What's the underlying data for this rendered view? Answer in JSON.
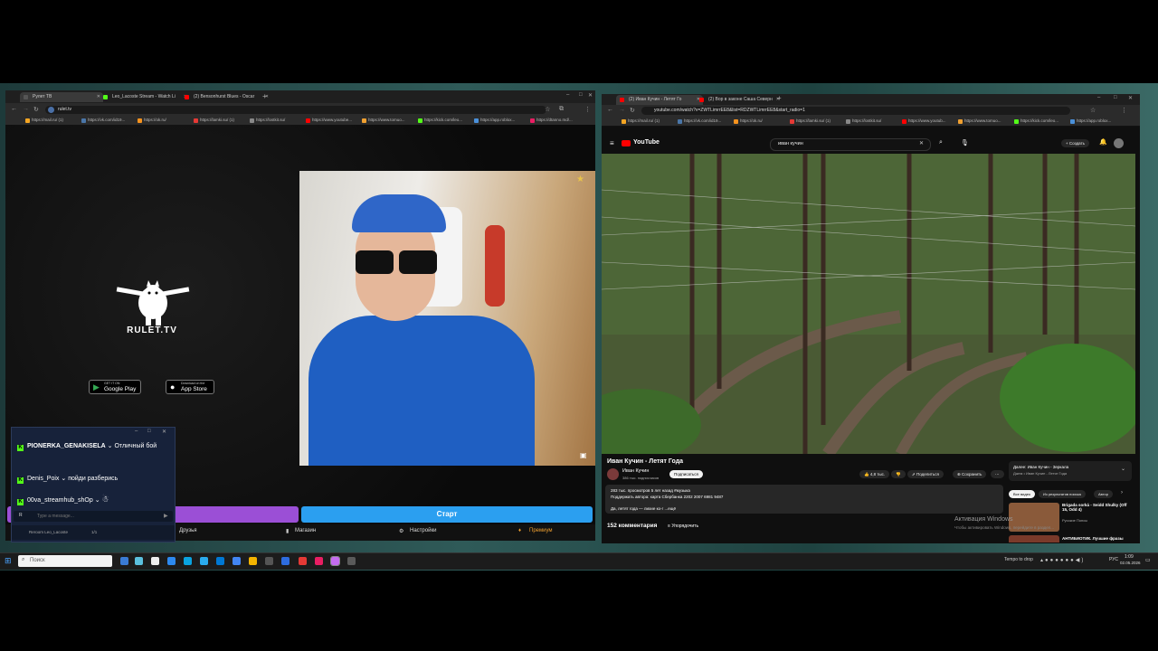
{
  "left_browser": {
    "tabs": [
      {
        "label": "Рулет ТВ",
        "color": "#2a2a2a"
      },
      {
        "label": "Leo_Lacoste Stream - Watch Li",
        "color": "#53fc18"
      },
      {
        "label": "(2) Bensonhurst Blues - Oscar",
        "color": "#ff0000"
      }
    ],
    "url": "rulet.tv",
    "bookmarks": [
      "https://mail.ru/ (1)",
      "https://vk.com/id19...",
      "https://ok.ru/",
      "https://lamki.su/ (1)",
      "https://lostkit.su/",
      "https://www.youtube...",
      "https://www.tomuo...",
      "https://kick.com/leo...",
      "https://app.roblox...",
      "https://dtanno.md/..."
    ]
  },
  "rulet": {
    "logo_text": "RULET.TV",
    "google_play": {
      "small": "GET IT ON",
      "label": "Google Play"
    },
    "app_store": {
      "small": "Download on the",
      "label": "App Store"
    },
    "start_button": "Старт",
    "nav": {
      "friends": "Друзья",
      "shop": "Магазин",
      "settings": "Настройки",
      "premium": "Премиум"
    }
  },
  "chat": {
    "messages": [
      {
        "user": "PIONERKA_GENAKISELA",
        "text": "Отличный бой"
      },
      {
        "user": "Denis_Poix",
        "text": "пойди разберись"
      },
      {
        "user": "00va_streamhub_shOp",
        "text": ""
      }
    ],
    "input_placeholder": "Type a message...",
    "footer_user": "Reroom Leo_Lacoste",
    "footer_count": "1/1"
  },
  "right_browser": {
    "tabs": [
      {
        "label": "(2) Иван Кучин - Летят Го",
        "color": "#ff0000"
      },
      {
        "label": "(2) Вор в законе Саша Северн",
        "color": "#ff0000"
      }
    ],
    "url": "youtube.com/watch?v=ZWTLimrrEE8&list=RDZWTLimrrEE8&start_radio=1",
    "bookmarks": [
      "https://mail.ru/ (1)",
      "https://vk.com/id19...",
      "https://ok.ru/",
      "https://lamki.su/ (1)",
      "https://lostkit.su/",
      "https://www.youtub...",
      "https://www.tomuo...",
      "https://kick.com/leo...",
      "https://app.roblox..."
    ]
  },
  "youtube": {
    "logo": "YouTube",
    "search_value": "иван кучин",
    "create_label": "Создать",
    "video_title": "Иван Кучин - Летят Года",
    "channel_name": "Иван Кучин",
    "subscribers": "386 тыс. подписчиков",
    "subscribe_label": "Подписаться",
    "likes": "4,8 тыс.",
    "share_label": "Поделиться",
    "save_label": "Сохранить",
    "views_line": "283 тыс. просмотров  5 лет назад  #музыка",
    "desc_line": "Поддержать автора: карта Сбербанка 2202 2007 6981 9487",
    "desc_line2": "Да, летят года — лихие ко-г ...ещё",
    "comments_count": "152 комментария",
    "sort_label": "Упорядочить",
    "playlist_title": "Далее: Иван Кучин - Зеркала",
    "playlist_sub": "Джем • Иван Кучин - Летят Года",
    "chips": [
      "Все видео",
      "Из результатов поиска",
      "Автор"
    ],
    "related": [
      {
        "title": "Brigada sorká - Seidd Shulky (Off 15, Odd 4)",
        "channel": "Русские Попсы"
      },
      {
        "title": "АНТИБИОТИК. Лучшие фразы",
        "channel": ""
      }
    ],
    "watermark_line1": "Активация Windows",
    "watermark_line2": "Чтобы активировать Windows, перейдите в раздел..."
  },
  "taskbar": {
    "search_placeholder": "Поиск",
    "tray_text": "Tempo to drop",
    "lang": "РУС",
    "time": "1:09",
    "date": "02.05.2026"
  }
}
